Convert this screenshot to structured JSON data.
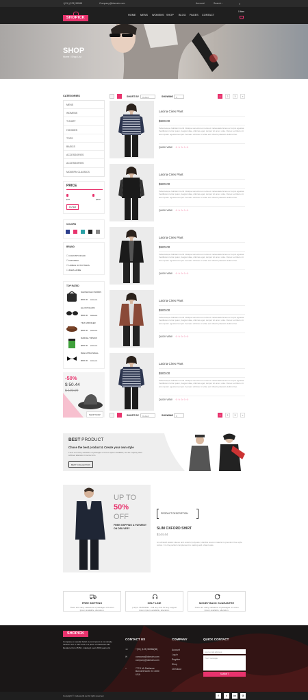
{
  "topbar": {
    "phone": "+(91) (123) 56568",
    "email": "Company@domain.com",
    "account": "Account",
    "search": "Search..."
  },
  "nav": {
    "logo": "SHOPICK",
    "items": [
      "HOME",
      "MENS",
      "WOMENS",
      "SHOP",
      "BLOG",
      "PAGES",
      "CONTACT"
    ],
    "cart_count": "0 Item"
  },
  "hero": {
    "title": "SHOP",
    "breadcrumb": "Home / Shop List"
  },
  "sidebar": {
    "categories_title": "CATEGORIES",
    "categories": [
      "MENS",
      "WOMENS",
      "T-SHIRT",
      "HOODIES",
      "TOPS",
      "BASICS",
      "ACCESSORIES",
      "ACCESSORIES",
      "MODERN CLASSICS"
    ],
    "price_title": "PRICE",
    "price_min": "$10",
    "price_max": "$150",
    "filter": "FILTER",
    "colors_title": "COLORS",
    "colors": [
      "#2c3e8c",
      "#e8336d",
      "#2aa1a6",
      "#222222",
      "#888888",
      "#e39a6a"
    ],
    "brand_title": "BRAND",
    "brands": [
      "COUNTRY ROAD",
      "FAB INDIA",
      "URBAN OUTFITTERS",
      "ZARA HOME"
    ],
    "top_title": "TOP RATED",
    "top_items": [
      {
        "name": "NAVASHVELO WORDS",
        "price": "$500.00",
        "old": "$550.00"
      },
      {
        "name": "ELLIS POLARIS",
        "price": "$500.00",
        "old": "$550.00"
      },
      {
        "name": "TINA SPRINGER",
        "price": "$500.00",
        "old": "$550.00"
      },
      {
        "name": "MARCEL TIMSOW",
        "price": "$500.00",
        "old": "$550.00"
      },
      {
        "name": "BLIE EXTRA SMALL",
        "price": "$500.00",
        "old": "$550.00"
      }
    ],
    "promo": {
      "percent": "-50%",
      "price": "$ 50.44",
      "old": "$ 102.99",
      "button": "SHOP NOW"
    }
  },
  "toolbar": {
    "sort_label": "SHORT BY",
    "sort_value": "Default",
    "show_label": "SHOWING",
    "show_value": "9",
    "pages": [
      "1",
      "2",
      "3",
      "»"
    ]
  },
  "products": [
    {
      "title": "Lacina Cires Pant",
      "price": "$500.00",
      "desc": "Pellentesque habitant morbi tristique senectus et netus et malesuada fames ac turpis egestas. Vestibulum tortor quam, feugiat vitae, ultricies eget, tempor sit amet, ante. Donec eu libero sit amet quam egestas semper. Aenean ultricies mi vitae est. Mauris placerat eleifend leo.",
      "quick": "QUICK VIEW",
      "stars": "☆☆☆☆☆"
    },
    {
      "title": "Lacina Cires Pant",
      "price": "$500.00",
      "desc": "Pellentesque habitant morbi tristique senectus et netus et malesuada fames ac turpis egestas. Vestibulum tortor quam, feugiat vitae, ultricies eget, tempor sit amet, ante. Donec eu libero sit amet quam egestas semper. Aenean ultricies mi vitae est. Mauris placerat eleifend leo.",
      "quick": "QUICK VIEW",
      "stars": "☆☆☆☆☆"
    },
    {
      "title": "Lacina Cires Pant",
      "price": "$500.00",
      "desc": "Pellentesque habitant morbi tristique senectus et netus et malesuada fames ac turpis egestas. Vestibulum tortor quam, feugiat vitae, ultricies eget, tempor sit amet, ante. Donec eu libero sit amet quam egestas semper. Aenean ultricies mi vitae est. Mauris placerat eleifend leo.",
      "quick": "QUICK VIEW",
      "stars": "☆☆☆☆☆"
    },
    {
      "title": "Lacina Cires Pant",
      "price": "$500.00",
      "desc": "Pellentesque habitant morbi tristique senectus et netus et malesuada fames ac turpis egestas. Vestibulum tortor quam, feugiat vitae, ultricies eget, tempor sit amet, ante. Donec eu libero sit amet quam egestas semper. Aenean ultricies mi vitae est. Mauris placerat eleifend leo.",
      "quick": "QUICK VIEW",
      "stars": "☆☆☆☆☆"
    },
    {
      "title": "Lacina Cires Pant",
      "price": "$500.00",
      "desc": "Pellentesque habitant morbi tristique senectus et netus et malesuada fames ac turpis egestas. Vestibulum tortor quam, feugiat vitae, ultricies eget, tempor sit amet, ante. Donec eu libero sit amet quam egestas semper. Aenean ultricies mi vitae est. Mauris placerat eleifend leo.",
      "quick": "QUICK VIEW",
      "stars": "☆☆☆☆☆"
    }
  ],
  "best": {
    "title_bold": "BEST",
    "title_rest": " PRODUCT",
    "subtitle": "Chose the best product & Create your own style",
    "text": "There are many variations of passages of Lorem Ipsum available, but the majority have suffered alteration in some form.",
    "button": "BEST COLLECTION"
  },
  "deal": {
    "up": "UP TO",
    "pct": "50%",
    "off": "OFF",
    "ship": "FREE SHIPPING & PAYMENT ON DELIVERY",
    "label": "PRODUCT DESCRIPTION",
    "name": "SLIM OXFORD SHIRT",
    "price": "$144.44",
    "text": "An ultrasoft elastic sleeve and exterior polyester, durable woven material is premium free style cotton. It is the perfect complement to casting and urban looks."
  },
  "features": [
    {
      "title": "FREE SHIPPING",
      "text": "There are many variations of passages of Lorem Ipsum available, alteration."
    },
    {
      "title": "HELP LINE",
      "text": "(+11) 0 762593531 - call any time for any support Lorem ipsum available, alteration."
    },
    {
      "title": "MONEY BACK GUARANTEE",
      "text": "There are many variations of passages of Lorem Ipsum available, alteration."
    }
  ],
  "footer": {
    "about": "Company or popular belief, Lorem Ipsum is not simply random text. It has roots in a piece of classical Latin literature from 45 BC, making it over 2000 years old.",
    "contact_title": "CONTACT US",
    "phone": "+(91) (123) 56568(66)",
    "email": "company@domain.com",
    "email2": "company@domain.com",
    "address": "777/1 Mr Radiance Bannerli North XX 4000 USA",
    "company_title": "COMPANY",
    "company_links": [
      "Account",
      "Log in",
      "Register",
      "Shop",
      "Checkout"
    ],
    "quick_title": "QUICK CONTACT",
    "email_ph": "your email address",
    "msg_ph": "Your message",
    "submit": "SUBMIT",
    "copyright": "Copyright © Codeworld.net All right reserved.",
    "social": [
      "f",
      "t",
      "in",
      "G"
    ]
  }
}
